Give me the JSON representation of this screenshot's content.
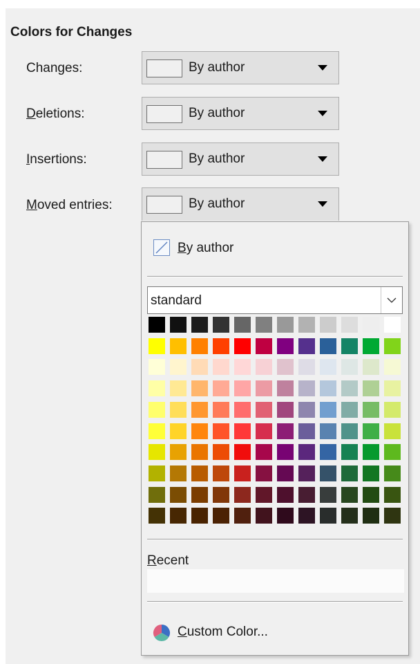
{
  "section": {
    "title": "Colors for Changes"
  },
  "rows": [
    {
      "label_pre": "Chan",
      "label_key": "g",
      "label_post": "es:",
      "value": "By author",
      "swatch_color": "#f0f0f0"
    },
    {
      "label_pre": "",
      "label_key": "D",
      "label_post": "eletions:",
      "value": "By author",
      "swatch_color": "#f0f0f0"
    },
    {
      "label_pre": "",
      "label_key": "I",
      "label_post": "nsertions:",
      "value": "By author",
      "swatch_color": "#f0f0f0"
    },
    {
      "label_pre": "",
      "label_key": "M",
      "label_post": "oved entries:",
      "value": "By author",
      "swatch_color": "#f0f0f0"
    }
  ],
  "popup": {
    "by_author_key": "B",
    "by_author_rest": "y author",
    "palette": "standard",
    "recent_key": "R",
    "recent_rest": "ecent",
    "custom_key": "C",
    "custom_rest": "ustom Color...",
    "colors": [
      [
        "#000000",
        "#111111",
        "#1c1c1c",
        "#333333",
        "#666666",
        "#808080",
        "#999999",
        "#b2b2b2",
        "#cccccc",
        "#dddddd",
        "#eeeeee",
        "#ffffff"
      ],
      [
        "#ffff00",
        "#ffbf00",
        "#ff8000",
        "#ff4000",
        "#ff0000",
        "#bf0041",
        "#800080",
        "#55308d",
        "#2a6099",
        "#158466",
        "#00a933",
        "#81d41a"
      ],
      [
        "#ffffd7",
        "#fff5ce",
        "#ffdbb6",
        "#ffd8ce",
        "#ffd7d7",
        "#f7d1d5",
        "#e0c2cd",
        "#dedce6",
        "#dee6ef",
        "#dee7e5",
        "#dde8cb",
        "#f6f9d4"
      ],
      [
        "#ffffa6",
        "#ffe994",
        "#ffb66c",
        "#ffaa95",
        "#ffa6a6",
        "#ec9ba4",
        "#bf819e",
        "#b7b3ca",
        "#b4c7dc",
        "#b3cac7",
        "#afd095",
        "#e8f2a1"
      ],
      [
        "#ffff6d",
        "#ffde59",
        "#ff972f",
        "#ff7b59",
        "#ff6d6d",
        "#e16173",
        "#a1467e",
        "#8e86ae",
        "#729fcf",
        "#81aca6",
        "#77bc65",
        "#d4ea6b"
      ],
      [
        "#ffff38",
        "#ffd428",
        "#ff860d",
        "#ff5429",
        "#ff3838",
        "#d62e4e",
        "#8d1d75",
        "#6b5e9b",
        "#5983b0",
        "#50938a",
        "#3faf46",
        "#c9e23b"
      ],
      [
        "#e6e600",
        "#e8a202",
        "#ea7500",
        "#ed4c05",
        "#f10d0c",
        "#a7074b",
        "#780373",
        "#5b277d",
        "#3465a4",
        "#168253",
        "#069a2e",
        "#5eb91e"
      ],
      [
        "#b2b200",
        "#b47804",
        "#b85c00",
        "#be480a",
        "#c9211e",
        "#861141",
        "#650953",
        "#55215b",
        "#355269",
        "#1e6a39",
        "#127622",
        "#468a1a"
      ],
      [
        "#706e0c",
        "#7b4d03",
        "#7b3d00",
        "#813709",
        "#8d281e",
        "#611729",
        "#4e102d",
        "#481d32",
        "#383d3c",
        "#28471f",
        "#224b12",
        "#395511"
      ],
      [
        "#443205",
        "#472702",
        "#492300",
        "#4b2204",
        "#50200e",
        "#41131d",
        "#2f0a1c",
        "#2d1424",
        "#292d2c",
        "#242f1b",
        "#1f2e12",
        "#2f3511"
      ]
    ]
  }
}
